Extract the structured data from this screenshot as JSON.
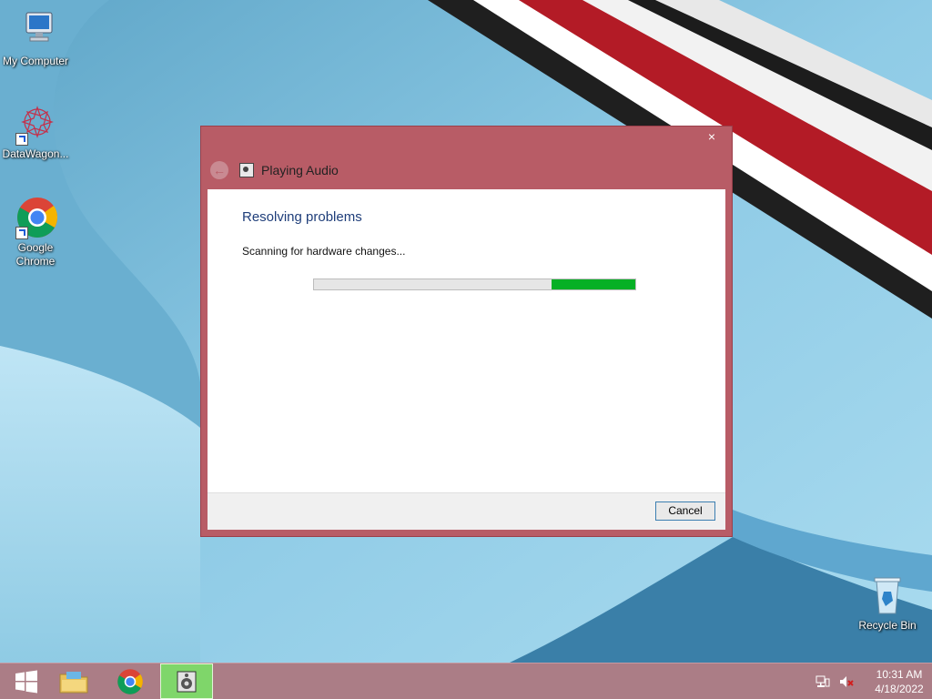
{
  "desktop": {
    "icons": [
      {
        "label": "My Computer",
        "icon": "computer-icon"
      },
      {
        "label": "DataWagon...",
        "icon": "datawagon-icon"
      },
      {
        "label": "Google Chrome",
        "icon": "chrome-icon"
      },
      {
        "label": "Recycle Bin",
        "icon": "recycle-bin-icon"
      }
    ]
  },
  "window": {
    "title": "Playing Audio",
    "close_glyph": "×",
    "back_glyph": "←",
    "heading": "Resolving problems",
    "status": "Scanning for hardware changes...",
    "progress": {
      "indeterminate": true,
      "segment_fraction": 0.26
    },
    "cancel_label": "Cancel",
    "colors": {
      "frame": "#b85c66",
      "heading": "#1f3e7a",
      "progress": "#06b025"
    }
  },
  "taskbar": {
    "items": [
      {
        "name": "start-button",
        "icon": "windows-logo-icon"
      },
      {
        "name": "file-explorer",
        "icon": "folder-icon"
      },
      {
        "name": "chrome",
        "icon": "chrome-icon"
      },
      {
        "name": "troubleshooter",
        "icon": "troubleshooter-icon",
        "active": true
      }
    ],
    "tray": {
      "network_icon": "network-icon",
      "volume_icon": "volume-muted-icon",
      "time": "10:31 AM",
      "date": "4/18/2022"
    },
    "color": "#ab7d86"
  }
}
